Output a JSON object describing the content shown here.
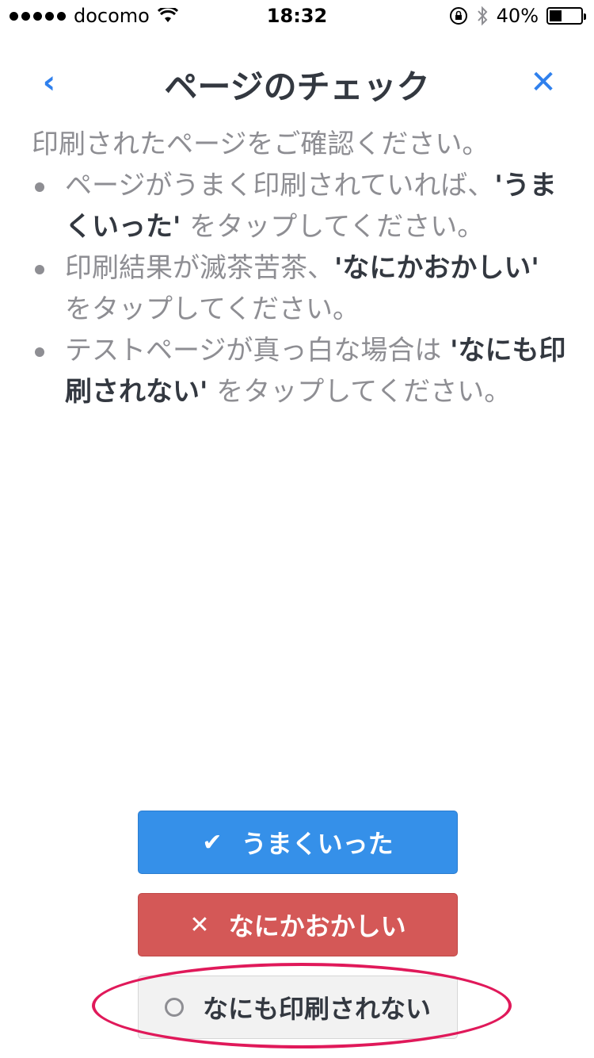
{
  "status_bar": {
    "carrier": "docomo",
    "time": "18:32",
    "battery_text": "40%",
    "battery_level": 0.4
  },
  "nav": {
    "back_icon": "‹",
    "title": "ページのチェック",
    "close_icon": "✕"
  },
  "instructions": {
    "intro": "印刷されたページをご確認ください。",
    "items": [
      {
        "pre": "ページがうまく印刷されていれば、",
        "bold": "'うまくいった'",
        "post": " をタップしてください。"
      },
      {
        "pre": "印刷結果が滅茶苦茶、",
        "bold": "'なにかおかしい'",
        "post": " をタップしてください。"
      },
      {
        "pre": "テストページが真っ白な場合は ",
        "bold": "'なにも印刷されない'",
        "post": " をタップしてください。"
      }
    ]
  },
  "buttons": {
    "ok": {
      "icon": "✔",
      "label": "うまくいった"
    },
    "wrong": {
      "icon": "✕",
      "label": "なにかおかしい"
    },
    "none": {
      "label": "なにも印刷されない"
    }
  },
  "colors": {
    "accent": "#3590e9",
    "danger": "#d45857",
    "highlight": "#e0195a"
  }
}
